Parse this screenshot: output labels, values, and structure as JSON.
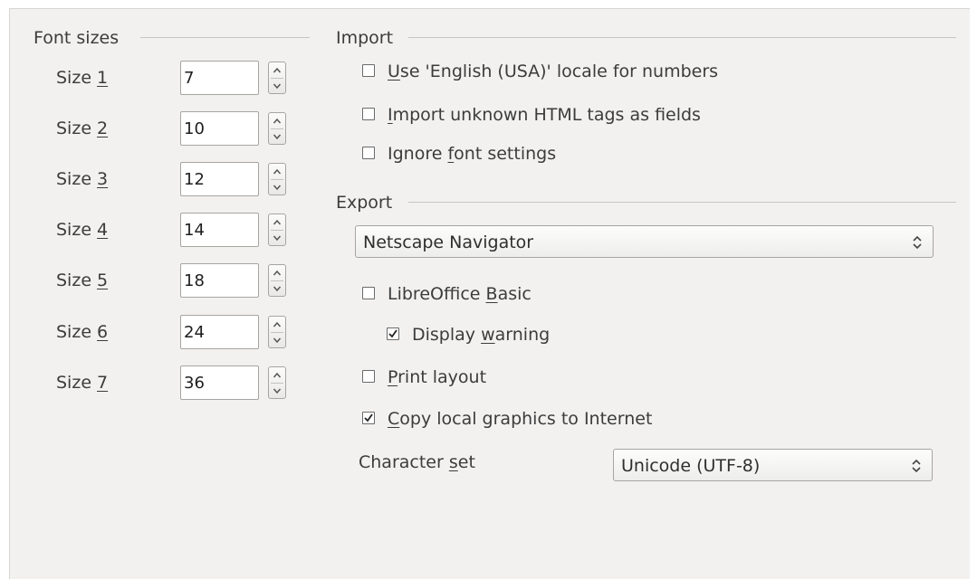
{
  "font_sizes": {
    "title": "Font sizes",
    "items": [
      {
        "label_pre": "Size ",
        "label_key": "1",
        "value": "7"
      },
      {
        "label_pre": "Size ",
        "label_key": "2",
        "value": "10"
      },
      {
        "label_pre": "Size ",
        "label_key": "3",
        "value": "12"
      },
      {
        "label_pre": "Size ",
        "label_key": "4",
        "value": "14"
      },
      {
        "label_pre": "Size ",
        "label_key": "5",
        "value": "18"
      },
      {
        "label_pre": "Size ",
        "label_key": "6",
        "value": "24"
      },
      {
        "label_pre": "Size ",
        "label_key": "7",
        "value": "36"
      }
    ]
  },
  "import": {
    "title": "Import",
    "use_english_locale": {
      "pre": "",
      "key": "U",
      "post": "se 'English (USA)' locale for numbers",
      "checked": false
    },
    "import_unknown_tags": {
      "pre": "",
      "key": "I",
      "post": "mport unknown HTML tags as fields",
      "checked": false
    },
    "ignore_font_settings": {
      "pre": "Ignore ",
      "key": "f",
      "post": "ont settings",
      "checked": false
    }
  },
  "export": {
    "title": "Export",
    "browser_selected": "Netscape Navigator",
    "libreoffice_basic": {
      "pre": "LibreOffice ",
      "key": "B",
      "post": "asic",
      "checked": false
    },
    "display_warning": {
      "pre": "Display ",
      "key": "w",
      "post": "arning",
      "checked": true
    },
    "print_layout": {
      "pre": "",
      "key": "P",
      "post": "rint layout",
      "checked": false
    },
    "copy_local_graphics": {
      "pre": "",
      "key": "C",
      "post": "opy local graphics to Internet",
      "checked": true
    },
    "character_set": {
      "pre": "Character ",
      "key": "s",
      "post": "et",
      "selected": "Unicode (UTF-8)"
    }
  },
  "icons": {
    "spin": "spin-up-down-icon",
    "dropdown": "up-down-chevron-icon",
    "check": "checkmark-icon"
  },
  "colors": {
    "panel_bg": "#f2f1f0",
    "field_border": "#a7a5a2",
    "text": "#3c3c3c"
  }
}
